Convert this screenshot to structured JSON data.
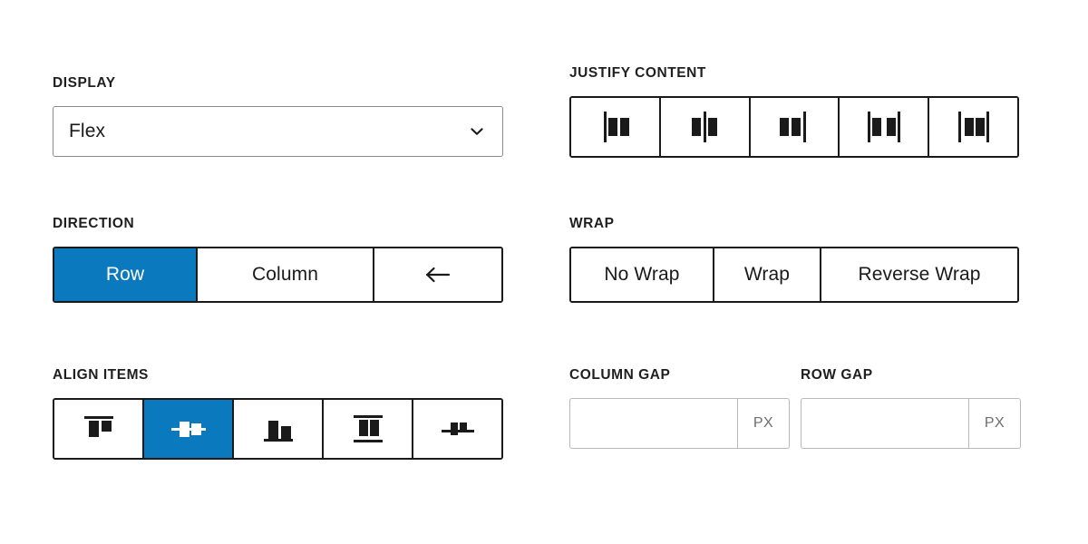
{
  "display": {
    "label": "DISPLAY",
    "value": "Flex",
    "chevron_icon": "chevron-down-icon"
  },
  "direction": {
    "label": "DIRECTION",
    "options": [
      {
        "label": "Row",
        "selected": true
      },
      {
        "label": "Column",
        "selected": false
      },
      {
        "label": "",
        "icon": "arrow-left-icon",
        "selected": false
      }
    ]
  },
  "align_items": {
    "label": "ALIGN ITEMS",
    "options": [
      {
        "icon": "align-flex-start-icon",
        "selected": false
      },
      {
        "icon": "align-center-icon",
        "selected": true
      },
      {
        "icon": "align-flex-end-icon",
        "selected": false
      },
      {
        "icon": "align-stretch-icon",
        "selected": false
      },
      {
        "icon": "align-baseline-icon",
        "selected": false
      }
    ]
  },
  "justify_content": {
    "label": "JUSTIFY CONTENT",
    "options": [
      {
        "icon": "justify-flex-start-icon",
        "selected": false
      },
      {
        "icon": "justify-center-icon",
        "selected": false
      },
      {
        "icon": "justify-flex-end-icon",
        "selected": false
      },
      {
        "icon": "justify-space-between-icon",
        "selected": false
      },
      {
        "icon": "justify-space-around-icon",
        "selected": false
      }
    ]
  },
  "wrap": {
    "label": "WRAP",
    "options": [
      {
        "label": "No Wrap",
        "selected": false
      },
      {
        "label": "Wrap",
        "selected": false
      },
      {
        "label": "Reverse Wrap",
        "selected": false
      }
    ]
  },
  "column_gap": {
    "label": "COLUMN GAP",
    "value": "",
    "placeholder": "",
    "unit": "PX"
  },
  "row_gap": {
    "label": "ROW GAP",
    "value": "",
    "placeholder": "",
    "unit": "PX"
  },
  "colors": {
    "accent": "#0b79be",
    "border_strong": "#1a1a1a",
    "border_medium": "#8a8a8a",
    "border_light": "#b9b9b9",
    "text": "#1a1a1a",
    "unit_text": "#6d6d6d",
    "background": "#ffffff"
  }
}
